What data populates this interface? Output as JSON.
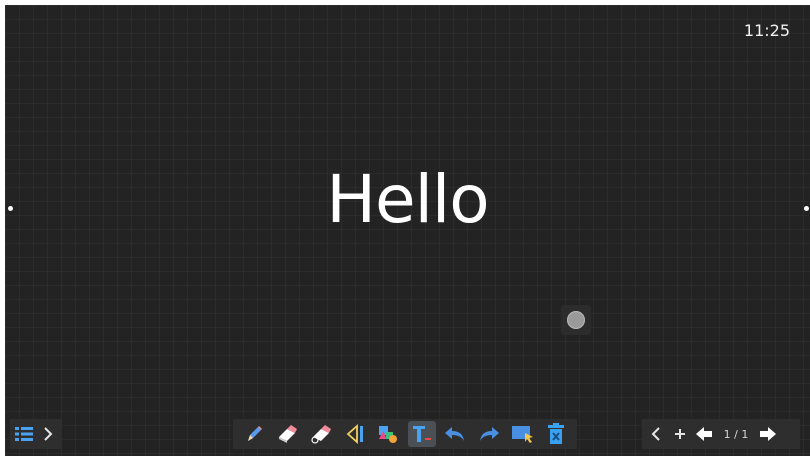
{
  "status": {
    "time": "11:25"
  },
  "canvas": {
    "text": "Hello"
  },
  "toolbar": {
    "tools": [
      "pencil-icon",
      "eraser-icon",
      "clear-eraser-icon",
      "ruler-icon",
      "shapes-icon",
      "text-tool-icon",
      "undo-icon",
      "redo-icon",
      "select-icon",
      "delete-icon"
    ],
    "active_tool": "text-tool-icon"
  },
  "pager": {
    "current": 1,
    "total": 1,
    "label": "1 / 1"
  },
  "colors": {
    "board": "#232323",
    "accent_blue": "#4a90e2",
    "pencil": "#5b9bf0",
    "eraser": "#f28c9c",
    "delete": "#3aa0f0"
  }
}
